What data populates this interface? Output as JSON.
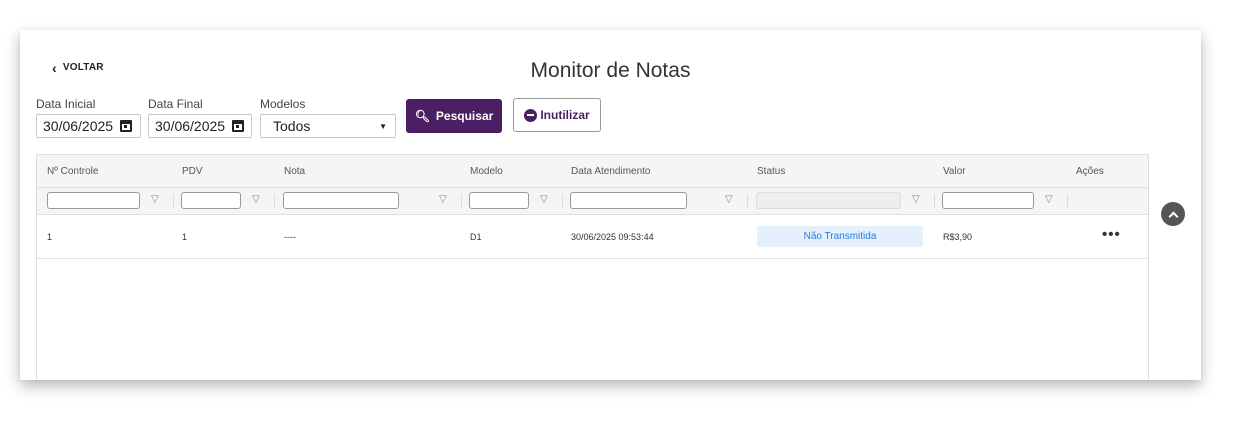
{
  "header": {
    "back_label": "VOLTAR",
    "title": "Monitor de Notas"
  },
  "filters": {
    "start_label": "Data Inicial",
    "start_value": "30/06/2025",
    "end_label": "Data Final",
    "end_value": "30/06/2025",
    "model_label": "Modelos",
    "model_value": "Todos",
    "search_label": "Pesquisar",
    "inutilizar_label": "Inutilizar"
  },
  "grid": {
    "columns": [
      "Nº Controle",
      "PDV",
      "Nota",
      "Modelo",
      "Data Atendimento",
      "Status",
      "Valor",
      "Ações"
    ],
    "rows": [
      {
        "controle": "1",
        "pdv": "1",
        "nota": "----",
        "modelo": "D1",
        "data": "30/06/2025 09:53:44",
        "status": "Não Transmitida",
        "valor": "R$3,90",
        "acoes": "•••"
      }
    ]
  },
  "icons": {
    "back": "chevron-left-icon",
    "calendar": "calendar-icon",
    "search": "search-icon",
    "inutilizar": "minus-circle-icon",
    "filter": "funnel-icon",
    "scroll_top": "chevron-up-icon"
  },
  "colors": {
    "primary": "#4a1f63",
    "status_bg": "#e4f0fc",
    "status_text": "#2d7ad6"
  }
}
